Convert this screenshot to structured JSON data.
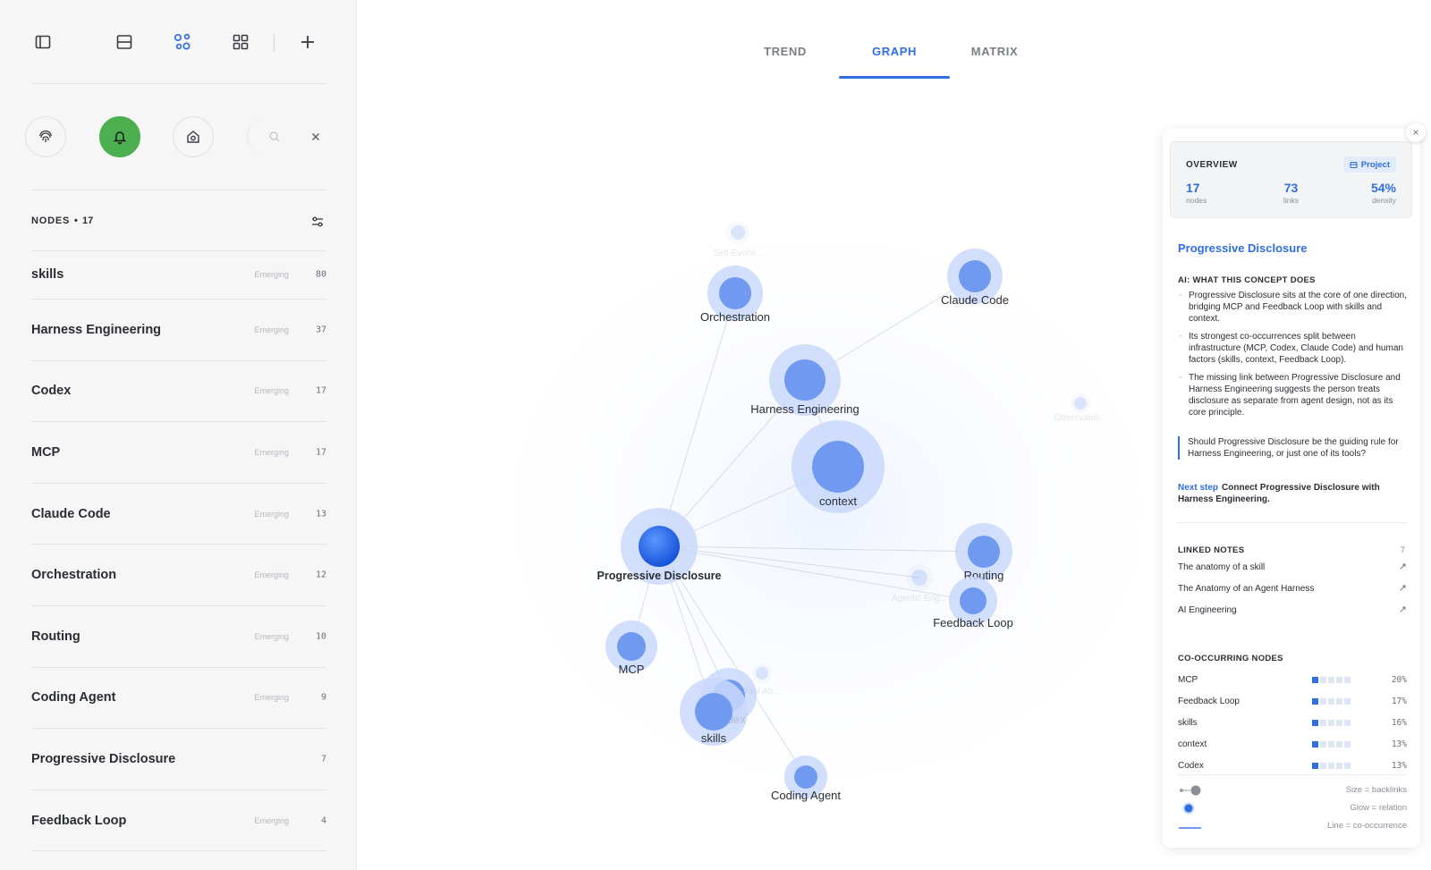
{
  "sidebar": {
    "nodes_title": "NODES",
    "nodes_sep": "•",
    "nodes_count": "17",
    "items": [
      {
        "name": "skills",
        "status": "Emerging",
        "count": "80"
      },
      {
        "name": "Harness Engineering",
        "status": "Emerging",
        "count": "37"
      },
      {
        "name": "Codex",
        "status": "Emerging",
        "count": "17"
      },
      {
        "name": "MCP",
        "status": "Emerging",
        "count": "17"
      },
      {
        "name": "Claude Code",
        "status": "Emerging",
        "count": "13"
      },
      {
        "name": "Orchestration",
        "status": "Emerging",
        "count": "12"
      },
      {
        "name": "Routing",
        "status": "Emerging",
        "count": "10"
      },
      {
        "name": "Coding Agent",
        "status": "Emerging",
        "count": "9"
      },
      {
        "name": "Progressive Disclosure",
        "status": "",
        "count": "7"
      },
      {
        "name": "Feedback Loop",
        "status": "Emerging",
        "count": "4"
      }
    ]
  },
  "tabs": [
    {
      "label": "TREND",
      "active": false
    },
    {
      "label": "GRAPH",
      "active": true
    },
    {
      "label": "MATRIX",
      "active": false
    }
  ],
  "graph": {
    "nodes": [
      {
        "label": "Progressive Disclosure",
        "selected": true
      },
      {
        "label": "context"
      },
      {
        "label": "Harness Engineering"
      },
      {
        "label": "Orchestration"
      },
      {
        "label": "Claude Code"
      },
      {
        "label": "Routing"
      },
      {
        "label": "Feedback Loop"
      },
      {
        "label": "MCP"
      },
      {
        "label": "Codex"
      },
      {
        "label": "skills"
      },
      {
        "label": "Coding Agent"
      },
      {
        "label": "Self-Evolvi...",
        "faded": true
      },
      {
        "label": "Agentic Eng...",
        "faded": true
      },
      {
        "label": "Tool Ab...",
        "faded": true
      },
      {
        "label": "Observabili...",
        "faded": true
      }
    ]
  },
  "panel": {
    "close_label": "×",
    "overview_title": "OVERVIEW",
    "badge": "Project",
    "stats": [
      {
        "value": "17",
        "label": "nodes"
      },
      {
        "value": "73",
        "label": "links"
      },
      {
        "value": "54%",
        "label": "density"
      }
    ],
    "concept_title": "Progressive Disclosure",
    "ai_section": "AI: WHAT THIS CONCEPT DOES",
    "bullets": [
      "Progressive Disclosure sits at the core of one direction, bridging MCP and Feedback Loop with skills and context.",
      "Its strongest co-occurrences split between infrastructure (MCP, Codex, Claude Code) and human factors (skills, context, Feedback Loop).",
      "The missing link between Progressive Disclosure and Harness Engineering suggests the person treats disclosure as separate from agent design, not as its core principle."
    ],
    "question": "Should Progressive Disclosure be the guiding rule for Harness Engineering, or just one of its tools?",
    "next_step_label": "Next step",
    "next_step_text": "Connect Progressive Disclosure with Harness Engineering.",
    "linked_title": "LINKED NOTES",
    "linked_count": "7",
    "linked": [
      {
        "title": "The anatomy of a skill",
        "arrow": "↗"
      },
      {
        "title": "The Anatomy of an Agent Harness",
        "arrow": "↗"
      },
      {
        "title": "AI Engineering",
        "arrow": "↗"
      }
    ],
    "co_title": "CO-OCCURRING NODES",
    "co": [
      {
        "name": "MCP",
        "pct": "20%",
        "filled": 1
      },
      {
        "name": "Feedback Loop",
        "pct": "17%",
        "filled": 1
      },
      {
        "name": "skills",
        "pct": "16%",
        "filled": 1
      },
      {
        "name": "context",
        "pct": "13%",
        "filled": 1
      },
      {
        "name": "Codex",
        "pct": "13%",
        "filled": 1
      }
    ],
    "legend": [
      {
        "label": "Size = backlinks"
      },
      {
        "label": "Glow = relation"
      },
      {
        "label": "Line = co-occurrence"
      }
    ]
  },
  "colors": {
    "accent": "#2f6fe0",
    "active_green": "#4caf50",
    "node_fill": "#6f9af0",
    "node_glow": "#c9d8fb"
  }
}
